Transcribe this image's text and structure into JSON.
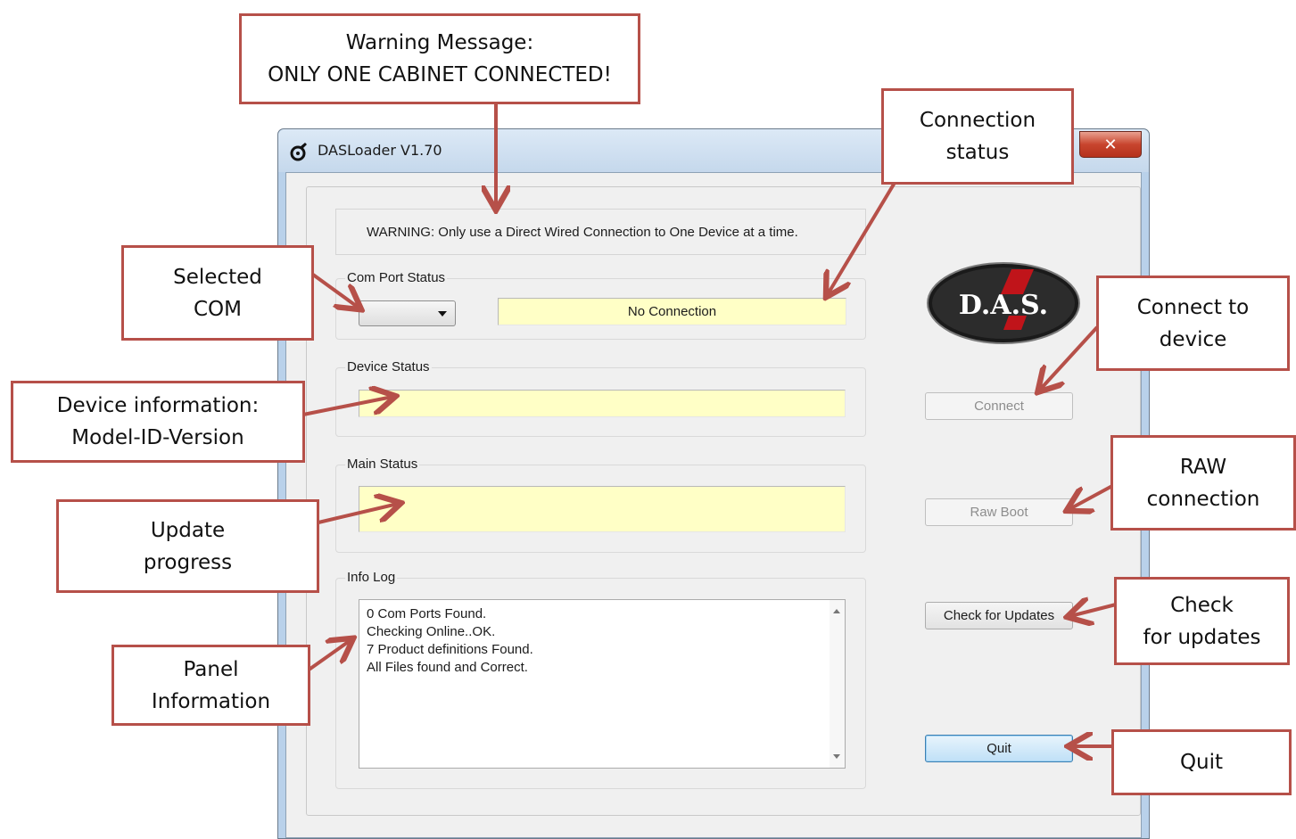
{
  "window": {
    "title": "DASLoader V1.70",
    "close_label": "✕",
    "warning_text": "WARNING: Only use a Direct Wired Connection to One Device at a time."
  },
  "com_port": {
    "group_label": "Com Port Status",
    "selected_value": "",
    "status_text": "No Connection"
  },
  "device_status": {
    "group_label": "Device Status",
    "value": ""
  },
  "main_status": {
    "group_label": "Main Status",
    "value": ""
  },
  "info_log": {
    "group_label": "Info Log",
    "lines": [
      "0 Com Ports Found.",
      "Checking Online..OK.",
      "7 Product definitions Found.",
      "All Files found and Correct."
    ]
  },
  "logo_text": "D.A.S.",
  "buttons": {
    "connect": "Connect",
    "raw_boot": "Raw Boot",
    "check_updates": "Check for Updates",
    "quit": "Quit"
  },
  "annotations": {
    "warning": [
      "Warning Message:",
      "ONLY ONE CABINET CONNECTED!"
    ],
    "connection_status": [
      "Connection",
      "status"
    ],
    "selected_com": [
      "Selected",
      "COM"
    ],
    "device_info": [
      "Device information:",
      "Model-ID-Version"
    ],
    "update_progress": [
      "Update",
      "progress"
    ],
    "panel_info": [
      "Panel",
      "Information"
    ],
    "connect_device": [
      "Connect to",
      "device"
    ],
    "raw_connection": [
      "RAW",
      "connection"
    ],
    "check_updates": [
      "Check",
      "for updates"
    ],
    "quit": [
      "Quit"
    ]
  },
  "colors": {
    "callout_border": "#b65049",
    "status_field": "#ffffc6",
    "window_chrome": "#b9d1ea"
  }
}
